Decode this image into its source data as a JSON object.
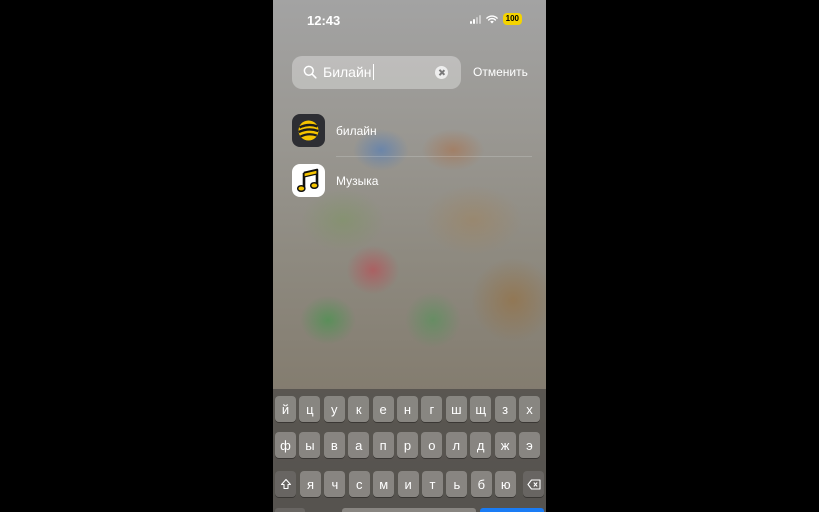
{
  "status_bar": {
    "time": "12:43",
    "battery": "100",
    "battery_color": "#f5d400"
  },
  "search": {
    "value": "Билайн",
    "cancel_label": "Отменить"
  },
  "results": [
    {
      "label": "билайн",
      "icon": "beeline-logo-icon"
    },
    {
      "label": "Музыка",
      "icon": "music-note-icon"
    }
  ],
  "keyboard": {
    "row1": [
      "й",
      "ц",
      "у",
      "к",
      "е",
      "н",
      "г",
      "ш",
      "щ",
      "з",
      "х"
    ],
    "row2": [
      "ф",
      "ы",
      "в",
      "а",
      "п",
      "р",
      "о",
      "л",
      "д",
      "ж",
      "э"
    ],
    "row3": [
      "я",
      "ч",
      "с",
      "м",
      "и",
      "т",
      "ь",
      "б",
      "ю"
    ],
    "shift_icon": "shift-icon",
    "delete_icon": "backspace-icon"
  },
  "colors": {
    "accent_blue": "#1a7cf5",
    "beeline_yellow": "#f5c400"
  }
}
